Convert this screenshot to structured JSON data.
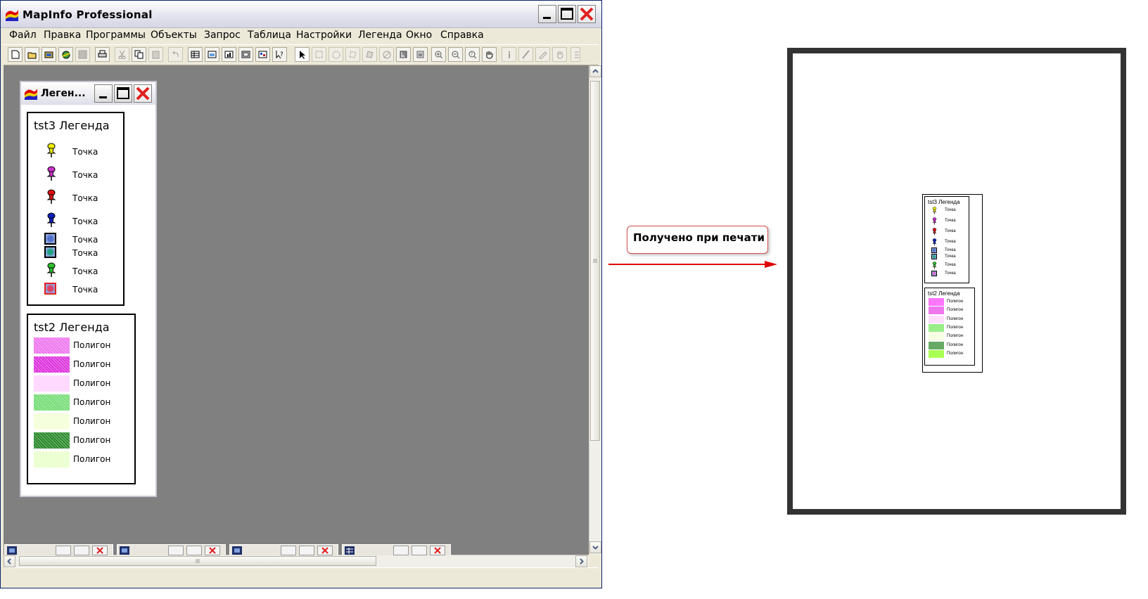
{
  "window": {
    "title": "MapInfo Professional"
  },
  "menu": [
    "Файл",
    "Правка",
    "Программы",
    "Объекты",
    "Запрос",
    "Таблица",
    "Настройки",
    "Легенда",
    "Окно",
    "Справка"
  ],
  "legend_window": {
    "title": "Леген...",
    "tst3": {
      "heading": "tst3 Легенда",
      "items": [
        {
          "label": "Точка",
          "symbol": "pin",
          "color": "#f0f000"
        },
        {
          "label": "Точка",
          "symbol": "pin",
          "color": "#cc33cc"
        },
        {
          "label": "Точка",
          "symbol": "pin",
          "color": "#e01010"
        },
        {
          "label": "Точка",
          "symbol": "pin",
          "color": "#1020c0"
        },
        {
          "label": "Точка",
          "symbol": "square",
          "color": "#4f6fc8"
        },
        {
          "label": "Точка",
          "symbol": "square",
          "color": "#20a080"
        },
        {
          "label": "Точка",
          "symbol": "pin",
          "color": "#30c030"
        },
        {
          "label": "Точка",
          "symbol": "square",
          "color": "#e04060"
        }
      ]
    },
    "tst2": {
      "heading": "tst2 Легенда",
      "items": [
        {
          "label": "Полигон",
          "color": "#ee77ee"
        },
        {
          "label": "Полигон",
          "color": "#dd33dd"
        },
        {
          "label": "Полигон",
          "color": "#ffd4ff"
        },
        {
          "label": "Полигон",
          "color": "#77dd77"
        },
        {
          "label": "Полигон",
          "color": "#f4ffd8"
        },
        {
          "label": "Полигон",
          "color": "#2a8a2a"
        },
        {
          "label": "Полигон",
          "color": "#eaffcc"
        }
      ]
    }
  },
  "annotation": {
    "text": "Получено при печати"
  },
  "printed": {
    "tst3": {
      "heading": "tst3 Легенда",
      "items": [
        {
          "label": "Точка",
          "symbol": "pin",
          "color": "#f0f000"
        },
        {
          "label": "Точка",
          "symbol": "pin",
          "color": "#cc33cc"
        },
        {
          "label": "Точка",
          "symbol": "pin",
          "color": "#e01010"
        },
        {
          "label": "Точка",
          "symbol": "pin",
          "color": "#1020c0"
        },
        {
          "label": "Точка",
          "symbol": "square",
          "color": "#4f6fc8"
        },
        {
          "label": "Точка",
          "symbol": "square",
          "color": "#20a080"
        },
        {
          "label": "Точка",
          "symbol": "pin",
          "color": "#30c030"
        },
        {
          "label": "Точка",
          "symbol": "square",
          "color": "#dd66cc"
        }
      ]
    },
    "tst2": {
      "heading": "tst2 Легенда",
      "items": [
        {
          "label": "Полигон",
          "color": "#ff77ff"
        },
        {
          "label": "Полигон",
          "color": "#ee77ee"
        },
        {
          "label": "Полигон",
          "color": "#ffddff"
        },
        {
          "label": "Полигон",
          "color": "#99ee88"
        },
        {
          "label": "Полигон",
          "color": "#f6ffe2"
        },
        {
          "label": "Полигон",
          "color": "#66aa66"
        },
        {
          "label": "Полигон",
          "color": "#aaff55"
        }
      ]
    }
  }
}
